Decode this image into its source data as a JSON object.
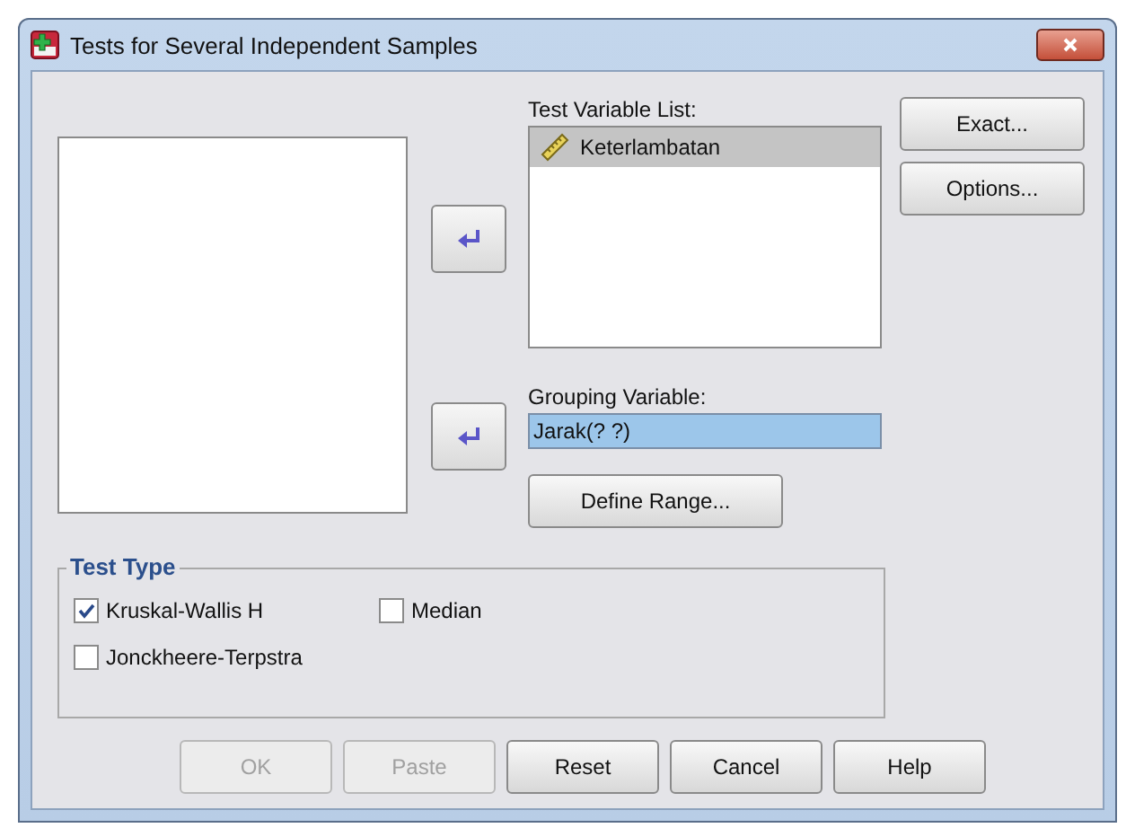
{
  "window": {
    "title": "Tests for Several Independent Samples"
  },
  "test_variable_list": {
    "label": "Test Variable List:",
    "items": [
      {
        "name": "Keterlambatan",
        "selected": true
      }
    ]
  },
  "grouping_variable": {
    "label": "Grouping Variable:",
    "value": "Jarak(? ?)",
    "selected": true
  },
  "define_range_button": "Define Range...",
  "side_buttons": [
    "Exact...",
    "Options..."
  ],
  "test_type": {
    "title": "Test Type",
    "options": [
      {
        "label": "Kruskal-Wallis H",
        "checked": true
      },
      {
        "label": "Median",
        "checked": false
      },
      {
        "label": "Jonckheere-Terpstra",
        "checked": false
      }
    ]
  },
  "buttons": [
    {
      "label": "OK",
      "disabled": true
    },
    {
      "label": "Paste",
      "disabled": true
    },
    {
      "label": "Reset",
      "disabled": false
    },
    {
      "label": "Cancel",
      "disabled": false
    },
    {
      "label": "Help",
      "disabled": false
    }
  ]
}
